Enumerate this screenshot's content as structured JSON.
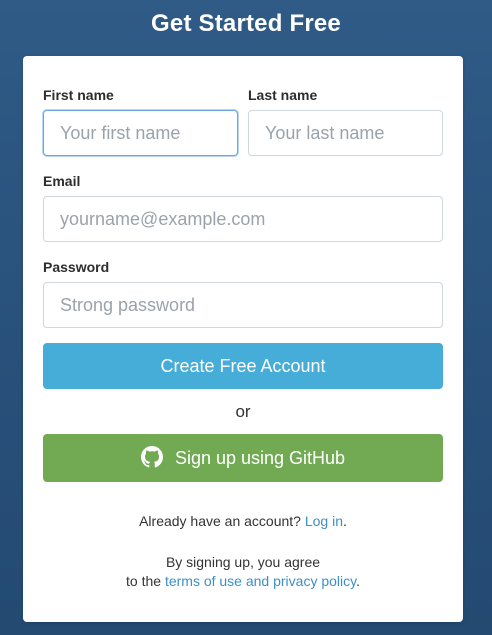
{
  "page": {
    "title": "Get Started Free"
  },
  "form": {
    "first_name": {
      "label": "First name",
      "placeholder": "Your first name",
      "value": ""
    },
    "last_name": {
      "label": "Last name",
      "placeholder": "Your last name",
      "value": ""
    },
    "email": {
      "label": "Email",
      "placeholder": "yourname@example.com",
      "value": ""
    },
    "password": {
      "label": "Password",
      "placeholder": "Strong password",
      "value": ""
    },
    "submit_label": "Create Free Account",
    "or_text": "or",
    "github": {
      "label": "Sign up using GitHub",
      "icon": "github-icon"
    }
  },
  "footer": {
    "login_prompt": "Already have an account?",
    "login_link": "Log in",
    "login_suffix": ".",
    "terms_prefix_line1": "By signing up, you agree",
    "terms_prefix_line2": "to the",
    "terms_link": "terms of use and privacy policy",
    "terms_suffix": "."
  },
  "colors": {
    "background": "#2a5480",
    "primary_button": "#46acd8",
    "github_button": "#71aa52",
    "link": "#3d8fc6"
  }
}
